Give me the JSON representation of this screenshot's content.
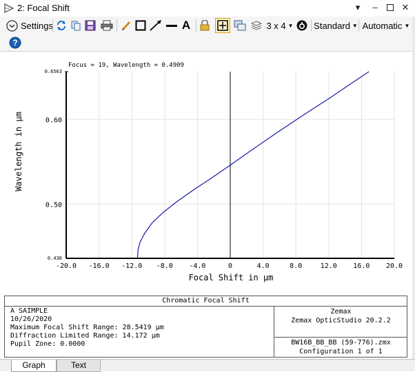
{
  "window": {
    "title": "2: Focal Shift"
  },
  "toolbar": {
    "settings_label": "Settings",
    "layout_label": "3 x 4",
    "style_label": "Standard",
    "scale_label": "Automatic"
  },
  "plot": {
    "header_text": "Focus = 19, Wavelength = 0.4909"
  },
  "chart_data": {
    "type": "line",
    "xlabel": "Focal Shift in µm",
    "ylabel": "Wavelength in µm",
    "xlim": [
      -20.0,
      20.0
    ],
    "ylim": [
      0.436,
      0.6563
    ],
    "x_ticks": [
      "-20.0",
      "-16.0",
      "-12.0",
      "-8.0",
      "-4.0",
      "0",
      "4.0",
      "8.0",
      "12.0",
      "16.0",
      "20.0"
    ],
    "y_ticks": [
      "0.436",
      "0.50",
      "0.60",
      "0.6563"
    ],
    "grid": true,
    "series": [
      {
        "color": "#1a1aa8",
        "x": [
          -11.3,
          -11.25,
          -11.0,
          -10.4,
          -9.5,
          -8.2,
          -6.5,
          -4.6,
          -2.4,
          0.0,
          2.8,
          5.8,
          8.9,
          12.1,
          15.3,
          16.9
        ],
        "y": [
          0.436,
          0.445,
          0.455,
          0.466,
          0.478,
          0.49,
          0.503,
          0.516,
          0.53,
          0.546,
          0.565,
          0.585,
          0.605,
          0.625,
          0.646,
          0.6563
        ]
      }
    ]
  },
  "footer": {
    "title": "Chromatic Focal Shift",
    "lines": [
      "A SAIMPLE",
      "10/26/2020",
      "Maximum Focal Shift Range: 28.5419 µm",
      "Diffraction Limited Range: 14.172 µm",
      "Pupil Zone: 0.0000"
    ],
    "right_top": [
      "Zemax",
      "Zemax OpticStudio 20.2.2"
    ],
    "right_bottom": [
      "BW16B_BB_BB (59-776).zmx",
      "Configuration 1 of 1"
    ]
  },
  "tabs": [
    {
      "label": "Graph"
    },
    {
      "label": "Text"
    }
  ],
  "colors": {
    "curve": "#1a1aa8",
    "highlight": "#d4a017"
  }
}
